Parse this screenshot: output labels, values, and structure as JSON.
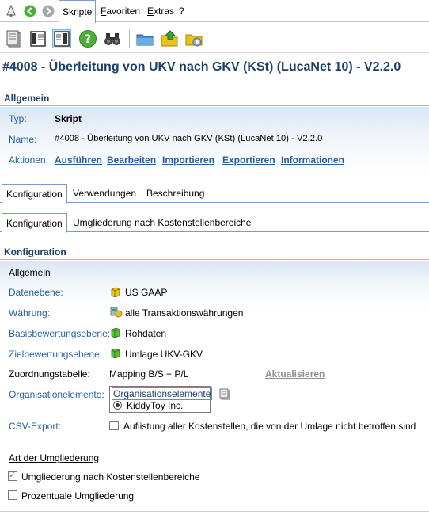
{
  "menu": {
    "skripte": "Skripte",
    "favoriten": "Favoriten",
    "extras": "Extras",
    "help": "?"
  },
  "toolbar_icons": [
    "server-icon",
    "single-pane-icon",
    "split-pane-icon",
    "help-icon",
    "binoculars-icon",
    "folder-icon",
    "folder-up-icon",
    "folder-settings-icon"
  ],
  "title": "#4008 - Überleitung von UKV nach GKV (KSt) (LucaNet 10) - V2.2.0",
  "allgemein": {
    "header": "Allgemein",
    "typ_label": "Typ:",
    "typ_value": "Skript",
    "name_label": "Name:",
    "name_value": "#4008 - Überleitung von UKV nach GKV (KSt) (LucaNet 10) - V2.2.0",
    "aktionen_label": "Aktionen:",
    "actions": [
      "Ausführen",
      "Bearbeiten",
      "Importieren",
      "Exportieren",
      "Informationen"
    ]
  },
  "tabs1": [
    "Konfiguration",
    "Verwendungen",
    "Beschreibung"
  ],
  "tabs2": [
    "Konfiguration",
    "Umgliederung nach Kostenstellenbereiche"
  ],
  "konfiguration": {
    "header": "Konfiguration",
    "group_allgemein": "Allgemein",
    "datenebene_label": "Datenebene:",
    "datenebene_value": "US GAAP",
    "waehrung_label": "Währung:",
    "waehrung_value": "alle Transaktionswährungen",
    "basis_label": "Basisbewertungsebene:",
    "basis_value": "Rohdaten",
    "ziel_label": "Zielbewertungsebene:",
    "ziel_value": "Umlage UKV-GKV",
    "zuordnung_label": "Zuordnungstabelle:",
    "zuordnung_value": "Mapping B/S + P/L",
    "aktualisieren": "Aktualisieren",
    "org_label": "Organisationelemente:",
    "org_header": "Organisationselemente",
    "org_item": "KiddyToy Inc.",
    "csv_label": "CSV-Export:",
    "csv_text": "Auflistung aller Kostenstellen, die von der Umlage nicht betroffen sind",
    "csv_checked": false,
    "group_art": "Art der Umgliederung",
    "opt1_text": "Umgliederung nach Kostenstellenbereiche",
    "opt1_checked": true,
    "opt2_text": "Prozentuale Umgliederung",
    "opt2_checked": false
  },
  "colors": {
    "header_text": "#1d3f6b",
    "label_blue": "#2b62a6",
    "link_blue": "#2b5d9e",
    "disabled_gray": "#8e8e8e",
    "accent_green": "#3aa23a",
    "accent_yellow": "#e9c21a"
  }
}
